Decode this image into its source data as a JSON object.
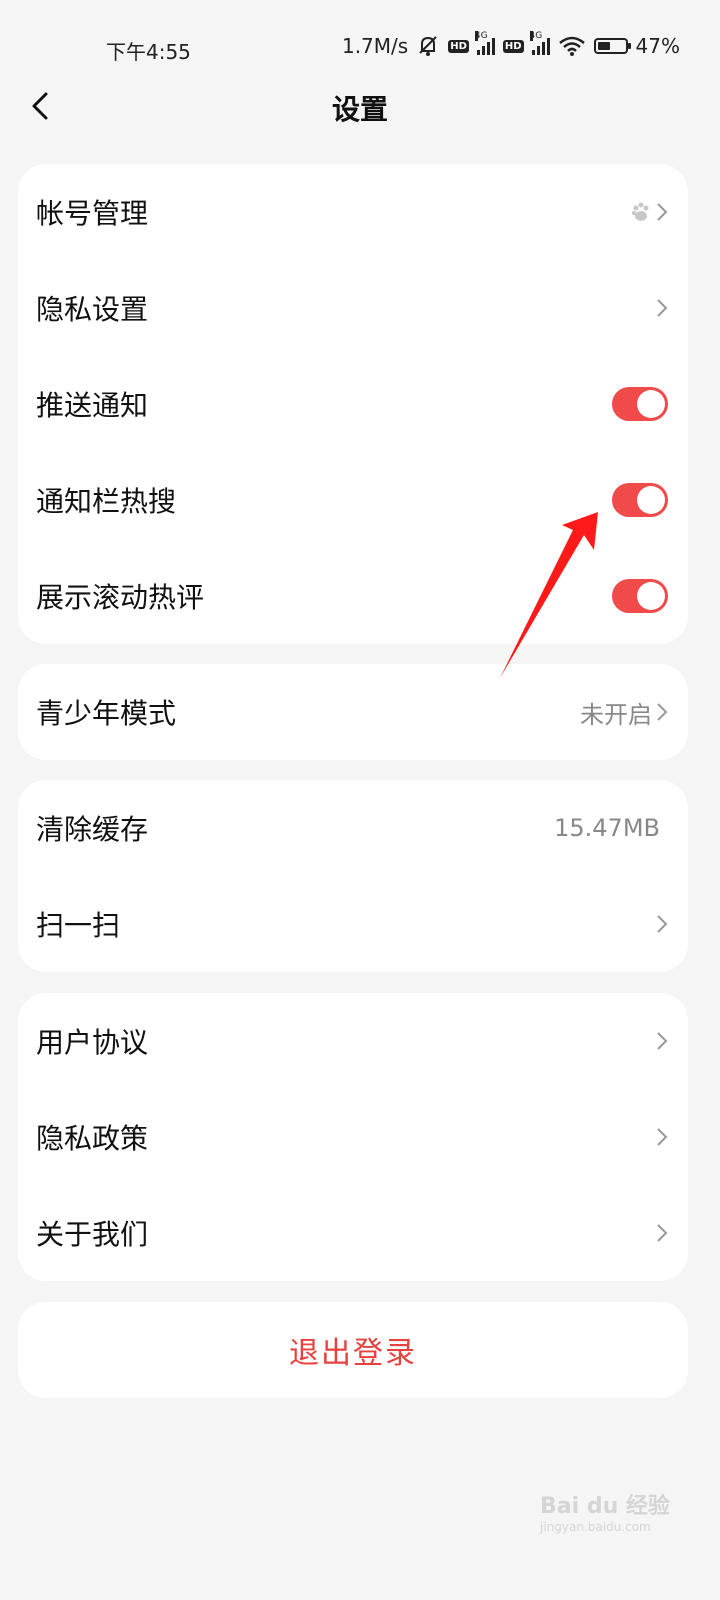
{
  "status_bar": {
    "time": "下午4:55",
    "speed": "1.7M/s",
    "network_1": "4G",
    "network_2": "4G",
    "hd_badge": "HD",
    "battery_level_percent": 47,
    "battery": "47%",
    "icons": [
      "mute-icon",
      "signal-icon",
      "wifi-icon",
      "battery-icon"
    ]
  },
  "header": {
    "title": "设置",
    "back_icon": "back-chevron-icon"
  },
  "groups": {
    "account": {
      "account_mgmt": "帐号管理",
      "privacy_settings": "隐私设置",
      "push_notify": "推送通知",
      "notify_hot": "通知栏热搜",
      "scroll_comments": "展示滚动热评",
      "push_notify_on": true,
      "notify_hot_on": true,
      "scroll_comments_on": true
    },
    "teen": {
      "label": "青少年模式",
      "value": "未开启"
    },
    "tools": {
      "clear_cache": "清除缓存",
      "cache_size": "15.47MB",
      "scan": "扫一扫"
    },
    "about": {
      "user_agreement": "用户协议",
      "privacy_policy": "隐私政策",
      "about_us": "关于我们"
    }
  },
  "logout": "退出登录",
  "colors": {
    "accent": "#f04a4a",
    "logout_text": "#e8403d",
    "background": "#f5f5f5",
    "card": "#ffffff"
  },
  "watermark": {
    "title": "Bai du 经验",
    "subtitle": "jingyan.baidu.com"
  }
}
